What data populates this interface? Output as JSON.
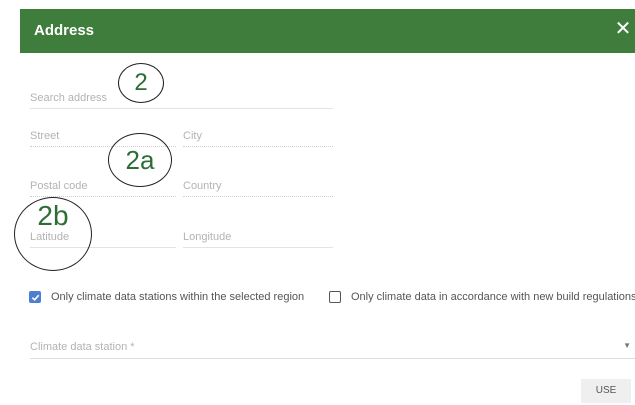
{
  "dialog": {
    "title": "Address",
    "close_glyph": "✕"
  },
  "form": {
    "search_placeholder": "Search address",
    "street_placeholder": "Street",
    "city_placeholder": "City",
    "postal_code_placeholder": "Postal code",
    "country_placeholder": "Country",
    "latitude_placeholder": "Latitude",
    "longitude_placeholder": "Longitude"
  },
  "annotations": {
    "a1": "2",
    "a2": "2a",
    "a3": "2b"
  },
  "options": {
    "region_only_label": "Only climate data stations within the selected region",
    "region_only_checked": true,
    "new_build_label": "Only climate data in accordance with new build regulations",
    "new_build_checked": false
  },
  "station_select": {
    "placeholder": "Climate data station *"
  },
  "actions": {
    "use_label": "USE"
  },
  "colors": {
    "header": "#3f7d3c",
    "checkbox_checked": "#4e7ed1",
    "annotation_text": "#2d6e36"
  },
  "icons": {
    "close": "close-icon",
    "caret": "chevron-down-icon",
    "check": "check-icon"
  }
}
